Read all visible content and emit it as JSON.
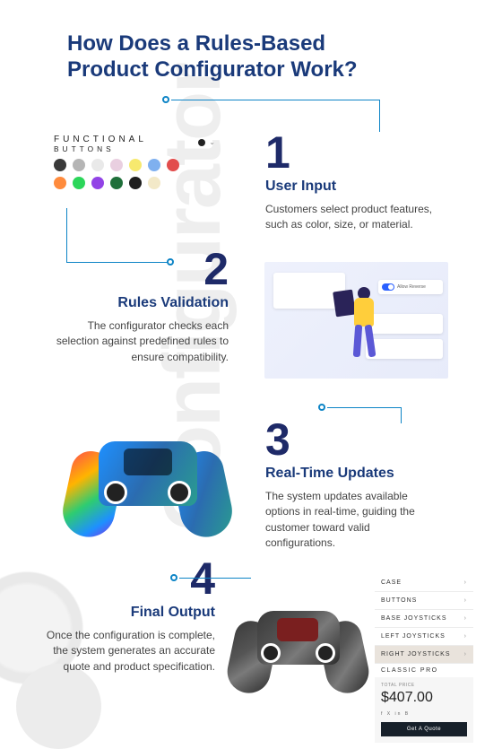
{
  "title": "How Does a Rules-Based Product Configurator Work?",
  "watermark": "Configurator",
  "swatches": {
    "label_line1": "FUNCTIONAL",
    "label_line2": "BUTTONS",
    "row1": [
      "#3a3a3a",
      "#b5b5b5",
      "#e9e9e9",
      "#e9cfe0",
      "#f7e96e",
      "#7fb0ef",
      "#e24d4d"
    ],
    "row2": [
      "#ff8b3d",
      "#2bd65a",
      "#9243e6",
      "#1f6f3a",
      "#1d1d1d",
      "#f3e9c8"
    ]
  },
  "steps": [
    {
      "num": "1",
      "heading": "User Input",
      "body": "Customers select product features, such as color, size, or material."
    },
    {
      "num": "2",
      "heading": "Rules Validation",
      "body": "The configurator checks each selection against predefined rules to ensure compatibility."
    },
    {
      "num": "3",
      "heading": "Real-Time Updates",
      "body": "The system updates available options in real-time, guiding the customer toward valid configurations."
    },
    {
      "num": "4",
      "heading": "Final Output",
      "body": "Once the configuration is complete, the system generates an accurate quote and product specification."
    }
  ],
  "rules_card": {
    "toggle_label": "Allow Reverse"
  },
  "spec": {
    "rows": [
      "CASE",
      "BUTTONS",
      "BASE JOYSTICKS",
      "LEFT JOYSTICKS",
      "RIGHT JOYSTICKS"
    ],
    "sub": "CLASSIC PRO",
    "fineprint": "TOTAL PRICE",
    "price": "$407.00",
    "icons": "f X in B",
    "cta": "Get A Quote"
  }
}
